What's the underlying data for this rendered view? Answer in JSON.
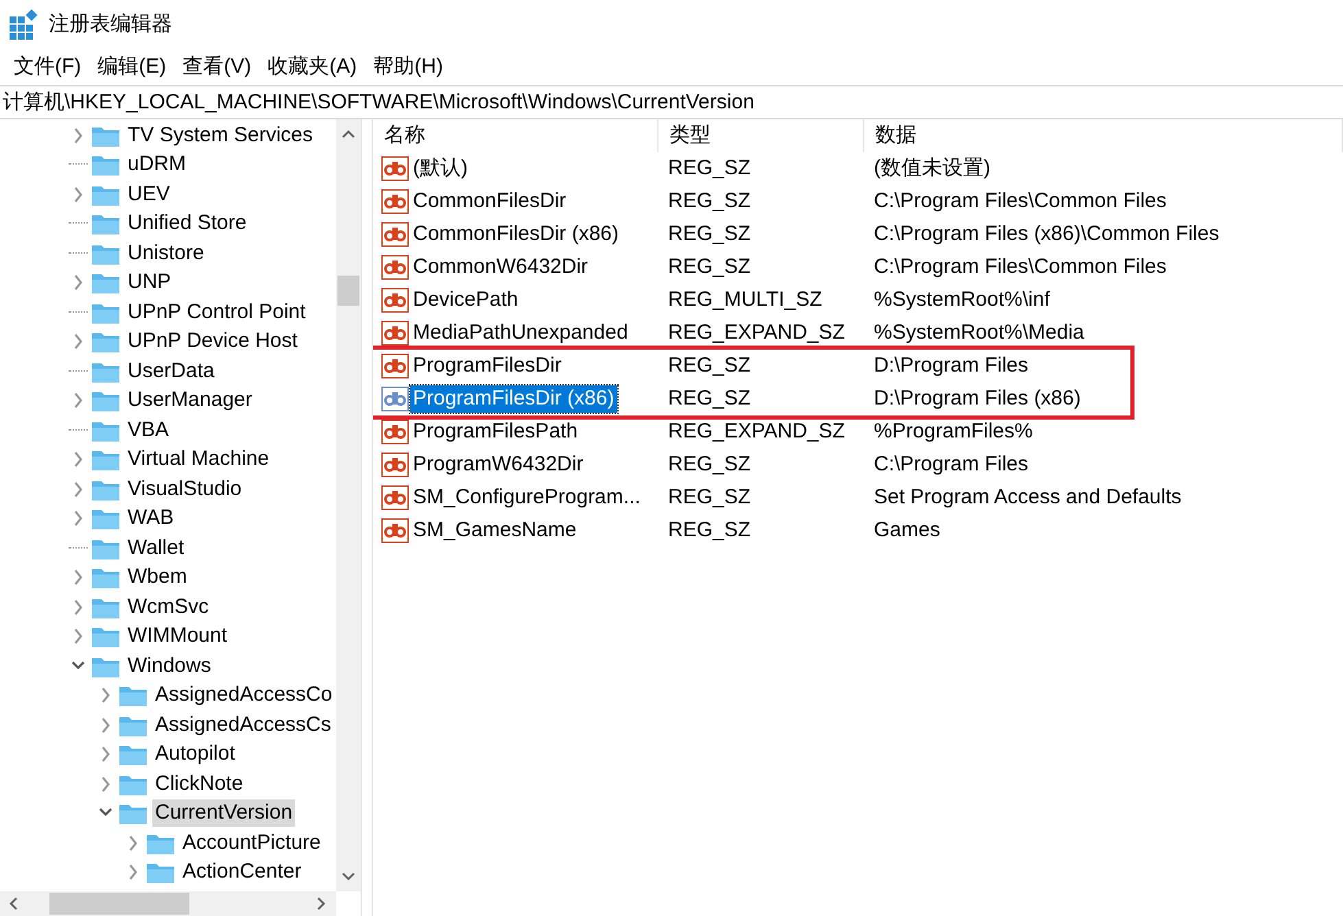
{
  "window": {
    "title": "注册表编辑器"
  },
  "menu": [
    "文件(F)",
    "编辑(E)",
    "查看(V)",
    "收藏夹(A)",
    "帮助(H)"
  ],
  "address": "计算机\\HKEY_LOCAL_MACHINE\\SOFTWARE\\Microsoft\\Windows\\CurrentVersion",
  "tree": [
    {
      "label": "TV System Services",
      "kind": "branch",
      "expanded": false,
      "selected": false
    },
    {
      "label": "uDRM",
      "kind": "leaf",
      "selected": false
    },
    {
      "label": "UEV",
      "kind": "branch",
      "expanded": false,
      "selected": false
    },
    {
      "label": "Unified Store",
      "kind": "leaf",
      "selected": false
    },
    {
      "label": "Unistore",
      "kind": "leaf",
      "selected": false
    },
    {
      "label": "UNP",
      "kind": "branch",
      "expanded": false,
      "selected": false
    },
    {
      "label": "UPnP Control Point",
      "kind": "leaf",
      "selected": false
    },
    {
      "label": "UPnP Device Host",
      "kind": "branch",
      "expanded": false,
      "selected": false
    },
    {
      "label": "UserData",
      "kind": "leaf",
      "selected": false
    },
    {
      "label": "UserManager",
      "kind": "branch",
      "expanded": false,
      "selected": false
    },
    {
      "label": "VBA",
      "kind": "leaf",
      "selected": false
    },
    {
      "label": "Virtual Machine",
      "kind": "branch",
      "expanded": false,
      "selected": false
    },
    {
      "label": "VisualStudio",
      "kind": "branch",
      "expanded": false,
      "selected": false
    },
    {
      "label": "WAB",
      "kind": "branch",
      "expanded": false,
      "selected": false
    },
    {
      "label": "Wallet",
      "kind": "leaf",
      "selected": false
    },
    {
      "label": "Wbem",
      "kind": "branch",
      "expanded": false,
      "selected": false
    },
    {
      "label": "WcmSvc",
      "kind": "branch",
      "expanded": false,
      "selected": false
    },
    {
      "label": "WIMMount",
      "kind": "branch",
      "expanded": false,
      "selected": false
    },
    {
      "label": "Windows",
      "kind": "branch",
      "expanded": true,
      "selected": false,
      "children": [
        {
          "label": "AssignedAccessCo",
          "kind": "branch",
          "expanded": false,
          "selected": false
        },
        {
          "label": "AssignedAccessCs",
          "kind": "branch",
          "expanded": false,
          "selected": false
        },
        {
          "label": "Autopilot",
          "kind": "branch",
          "expanded": false,
          "selected": false
        },
        {
          "label": "ClickNote",
          "kind": "branch",
          "expanded": false,
          "selected": false
        },
        {
          "label": "CurrentVersion",
          "kind": "branch",
          "expanded": true,
          "selected": true,
          "children": [
            {
              "label": "AccountPicture",
              "kind": "branch",
              "expanded": false,
              "selected": false
            },
            {
              "label": "ActionCenter",
              "kind": "branch",
              "expanded": false,
              "selected": false
            }
          ]
        }
      ]
    }
  ],
  "table": {
    "columns": [
      "名称",
      "类型",
      "数据"
    ],
    "rows": [
      {
        "name": "(默认)",
        "type": "REG_SZ",
        "data": "(数值未设置)",
        "selected": false,
        "marked": false
      },
      {
        "name": "CommonFilesDir",
        "type": "REG_SZ",
        "data": "C:\\Program Files\\Common Files",
        "selected": false,
        "marked": false
      },
      {
        "name": "CommonFilesDir (x86)",
        "type": "REG_SZ",
        "data": "C:\\Program Files (x86)\\Common Files",
        "selected": false,
        "marked": false
      },
      {
        "name": "CommonW6432Dir",
        "type": "REG_SZ",
        "data": "C:\\Program Files\\Common Files",
        "selected": false,
        "marked": false
      },
      {
        "name": "DevicePath",
        "type": "REG_MULTI_SZ",
        "data": "%SystemRoot%\\inf",
        "selected": false,
        "marked": false
      },
      {
        "name": "MediaPathUnexpanded",
        "type": "REG_EXPAND_SZ",
        "data": "%SystemRoot%\\Media",
        "selected": false,
        "marked": false
      },
      {
        "name": "ProgramFilesDir",
        "type": "REG_SZ",
        "data": "D:\\Program Files",
        "selected": false,
        "marked": true
      },
      {
        "name": "ProgramFilesDir (x86)",
        "type": "REG_SZ",
        "data": "D:\\Program Files (x86)",
        "selected": true,
        "marked": true
      },
      {
        "name": "ProgramFilesPath",
        "type": "REG_EXPAND_SZ",
        "data": "%ProgramFiles%",
        "selected": false,
        "marked": false
      },
      {
        "name": "ProgramW6432Dir",
        "type": "REG_SZ",
        "data": "C:\\Program Files",
        "selected": false,
        "marked": false
      },
      {
        "name": "SM_ConfigureProgram...",
        "type": "REG_SZ",
        "data": "Set Program Access and Defaults",
        "selected": false,
        "marked": false
      },
      {
        "name": "SM_GamesName",
        "type": "REG_SZ",
        "data": "Games",
        "selected": false,
        "marked": false
      }
    ]
  }
}
